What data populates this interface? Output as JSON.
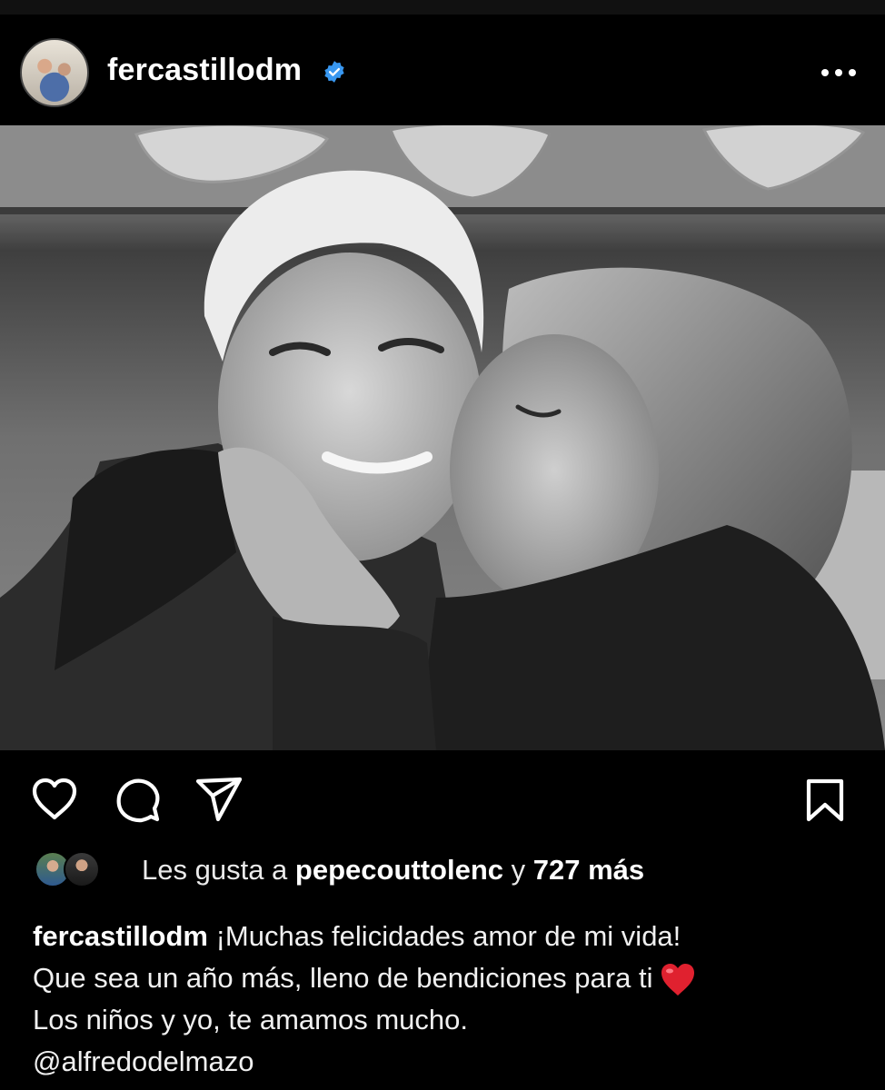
{
  "post": {
    "username": "fercastillodm",
    "verified": true,
    "photo_description_icon": "photo-icon"
  },
  "actions": {
    "like_icon": "heart-icon",
    "comment_icon": "comment-icon",
    "share_icon": "send-icon",
    "save_icon": "bookmark-icon"
  },
  "likes": {
    "prefix": "Les gusta a",
    "liker": "pepecouttolenc",
    "joiner": "y",
    "others": "727 más"
  },
  "caption": {
    "author": "fercastillodm",
    "line1": "¡Muchas felicidades amor de mi vida!",
    "line2": "Que sea un año más, lleno de bendiciones para ti",
    "line3": "Los niños y yo, te amamos mucho.",
    "mention": "@alfredodelmazo",
    "emoji": "red-heart-emoji"
  },
  "colors": {
    "background": "#000000",
    "verified_badge": "#3897f0",
    "text": "#f2f2f2",
    "emoji_red": "#e0212f"
  }
}
